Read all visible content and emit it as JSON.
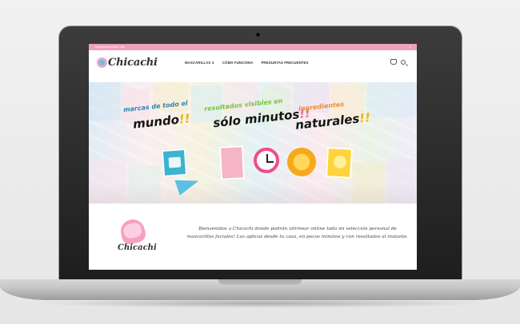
{
  "topbar": {
    "text": "Despachos a todo Chile",
    "social_icon": "f"
  },
  "header": {
    "logo_text": "Chicachi",
    "nav": [
      "MASCARILLAS ∨",
      "CÓMO FUNCIONA",
      "PREGUNTAS FRECUENTES"
    ]
  },
  "hero": {
    "line1a": "marcas de todo el",
    "line1b": "mundo",
    "line1b_bang": "!!",
    "line2a": "resultados visibles en",
    "line2b": "sólo minutos",
    "line2b_bang": "!!",
    "line3a": "ingredientes",
    "line3b": "naturales",
    "line3b_bang": "!!"
  },
  "intro": {
    "logo_name": "Chicachi",
    "text": "Bienvenidos a Chicachi donde podrán vitrinear online toda mi selección personal de mascarillas faciales! Las aplicas desde tu casa, en pocos minutos y con resultados al instante."
  }
}
